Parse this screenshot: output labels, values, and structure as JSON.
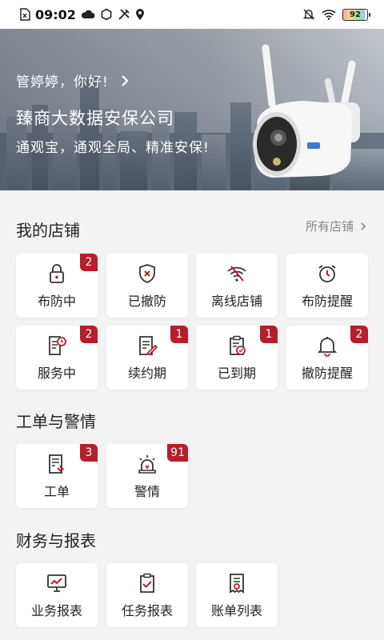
{
  "status_bar": {
    "time": "09:02",
    "battery": "92"
  },
  "banner": {
    "greeting": "管婷婷，你好!",
    "company": "臻商大数据安保公司",
    "slogan": "通观宝，通观全局、精准安保!"
  },
  "stores": {
    "title": "我的店铺",
    "more": "所有店铺",
    "items": [
      {
        "label": "布防中",
        "badge": "2",
        "icon": "lock-icon"
      },
      {
        "label": "已撤防",
        "badge": "",
        "icon": "shield-x-icon"
      },
      {
        "label": "离线店铺",
        "badge": "",
        "icon": "wifi-off-icon"
      },
      {
        "label": "布防提醒",
        "badge": "",
        "icon": "alarm-clock-icon"
      },
      {
        "label": "服务中",
        "badge": "2",
        "icon": "doc-clock-icon"
      },
      {
        "label": "续约期",
        "badge": "1",
        "icon": "doc-pen-icon"
      },
      {
        "label": "已到期",
        "badge": "1",
        "icon": "clipboard-clock-icon"
      },
      {
        "label": "撤防提醒",
        "badge": "2",
        "icon": "bell-icon"
      }
    ]
  },
  "orders": {
    "title": "工单与警情",
    "items": [
      {
        "label": "工单",
        "badge": "3",
        "icon": "work-order-icon"
      },
      {
        "label": "警情",
        "badge": "91",
        "icon": "siren-icon"
      }
    ]
  },
  "finance": {
    "title": "财务与报表",
    "items": [
      {
        "label": "业务报表",
        "badge": "",
        "icon": "chart-monitor-icon"
      },
      {
        "label": "任务报表",
        "badge": "",
        "icon": "clipboard-check-icon"
      },
      {
        "label": "账单列表",
        "badge": "",
        "icon": "bill-list-icon"
      }
    ]
  },
  "colors": {
    "accent": "#b51f2c",
    "icon": "#333333"
  }
}
